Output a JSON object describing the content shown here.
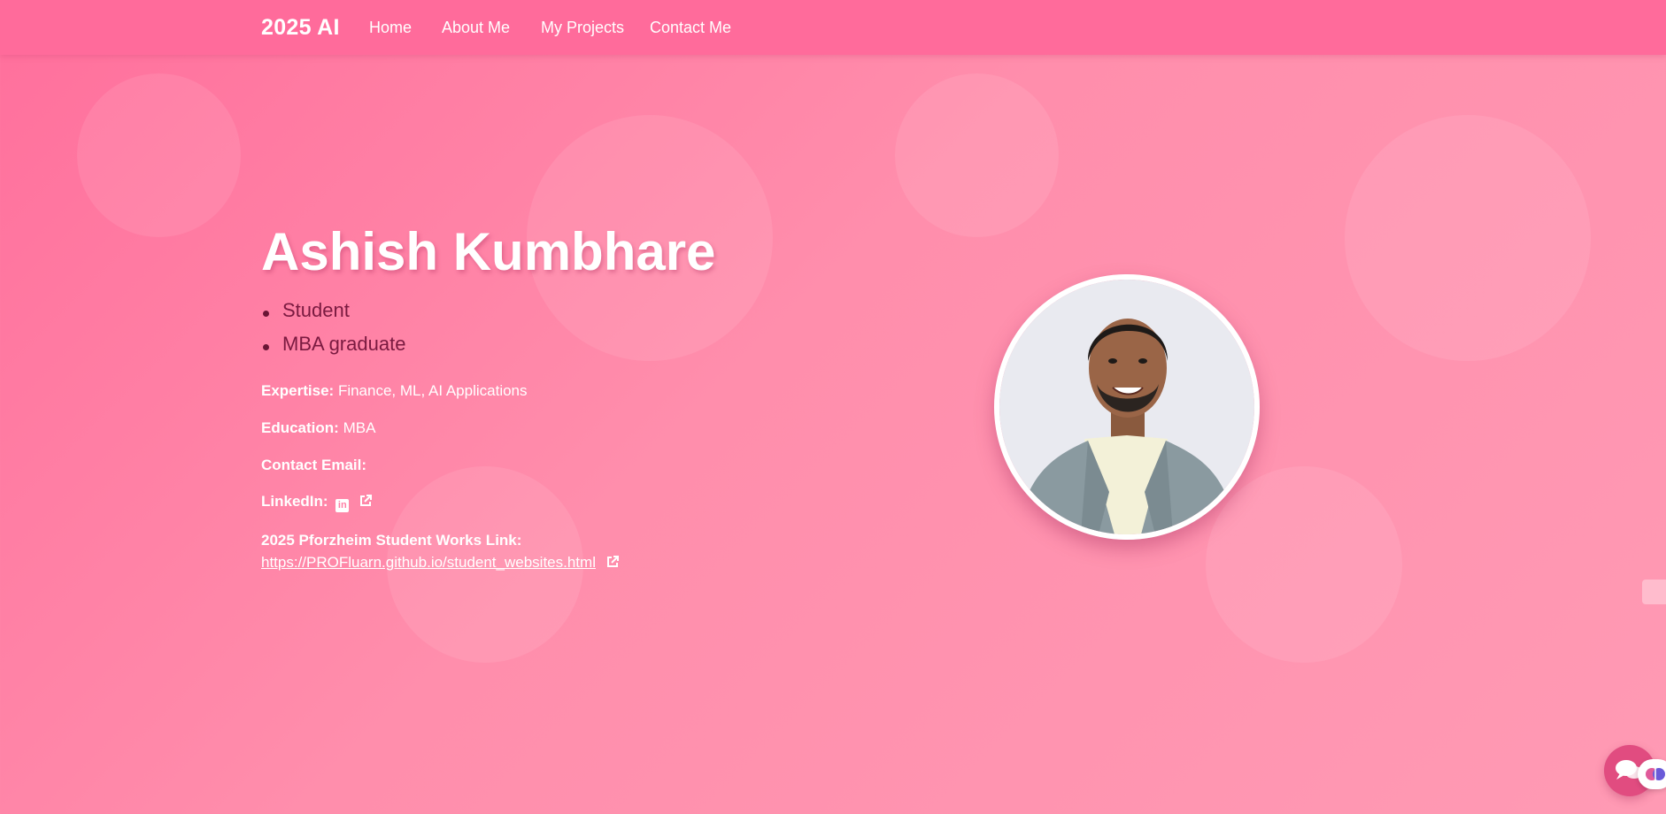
{
  "nav": {
    "brand": "2025 AI",
    "links": [
      "Home",
      "About Me",
      "My Projects",
      "Contact Me"
    ]
  },
  "hero": {
    "name": "Ashish Kumbhare",
    "roles": [
      "Student",
      "MBA graduate"
    ],
    "expertise_label": "Expertise:",
    "expertise_value": "Finance, ML, AI Applications",
    "education_label": "Education:",
    "education_value": "MBA",
    "contact_label": "Contact Email:",
    "linkedin_label": "LinkedIn:",
    "works_label": "2025 Pforzheim Student Works Link:",
    "works_link": "https://PROFluarn.github.io/student_websites.html"
  },
  "icons": {
    "linkedin": "linkedin-icon",
    "external": "external-link-icon",
    "chat": "chat-icon",
    "brain": "brain-icon"
  },
  "colors": {
    "nav_bg": "#ff6b9b",
    "page_gradient_start": "#ff6f9c",
    "page_gradient_end": "#ff9ab4",
    "role_text": "#7a1a40",
    "chat_button": "#e14c80"
  }
}
